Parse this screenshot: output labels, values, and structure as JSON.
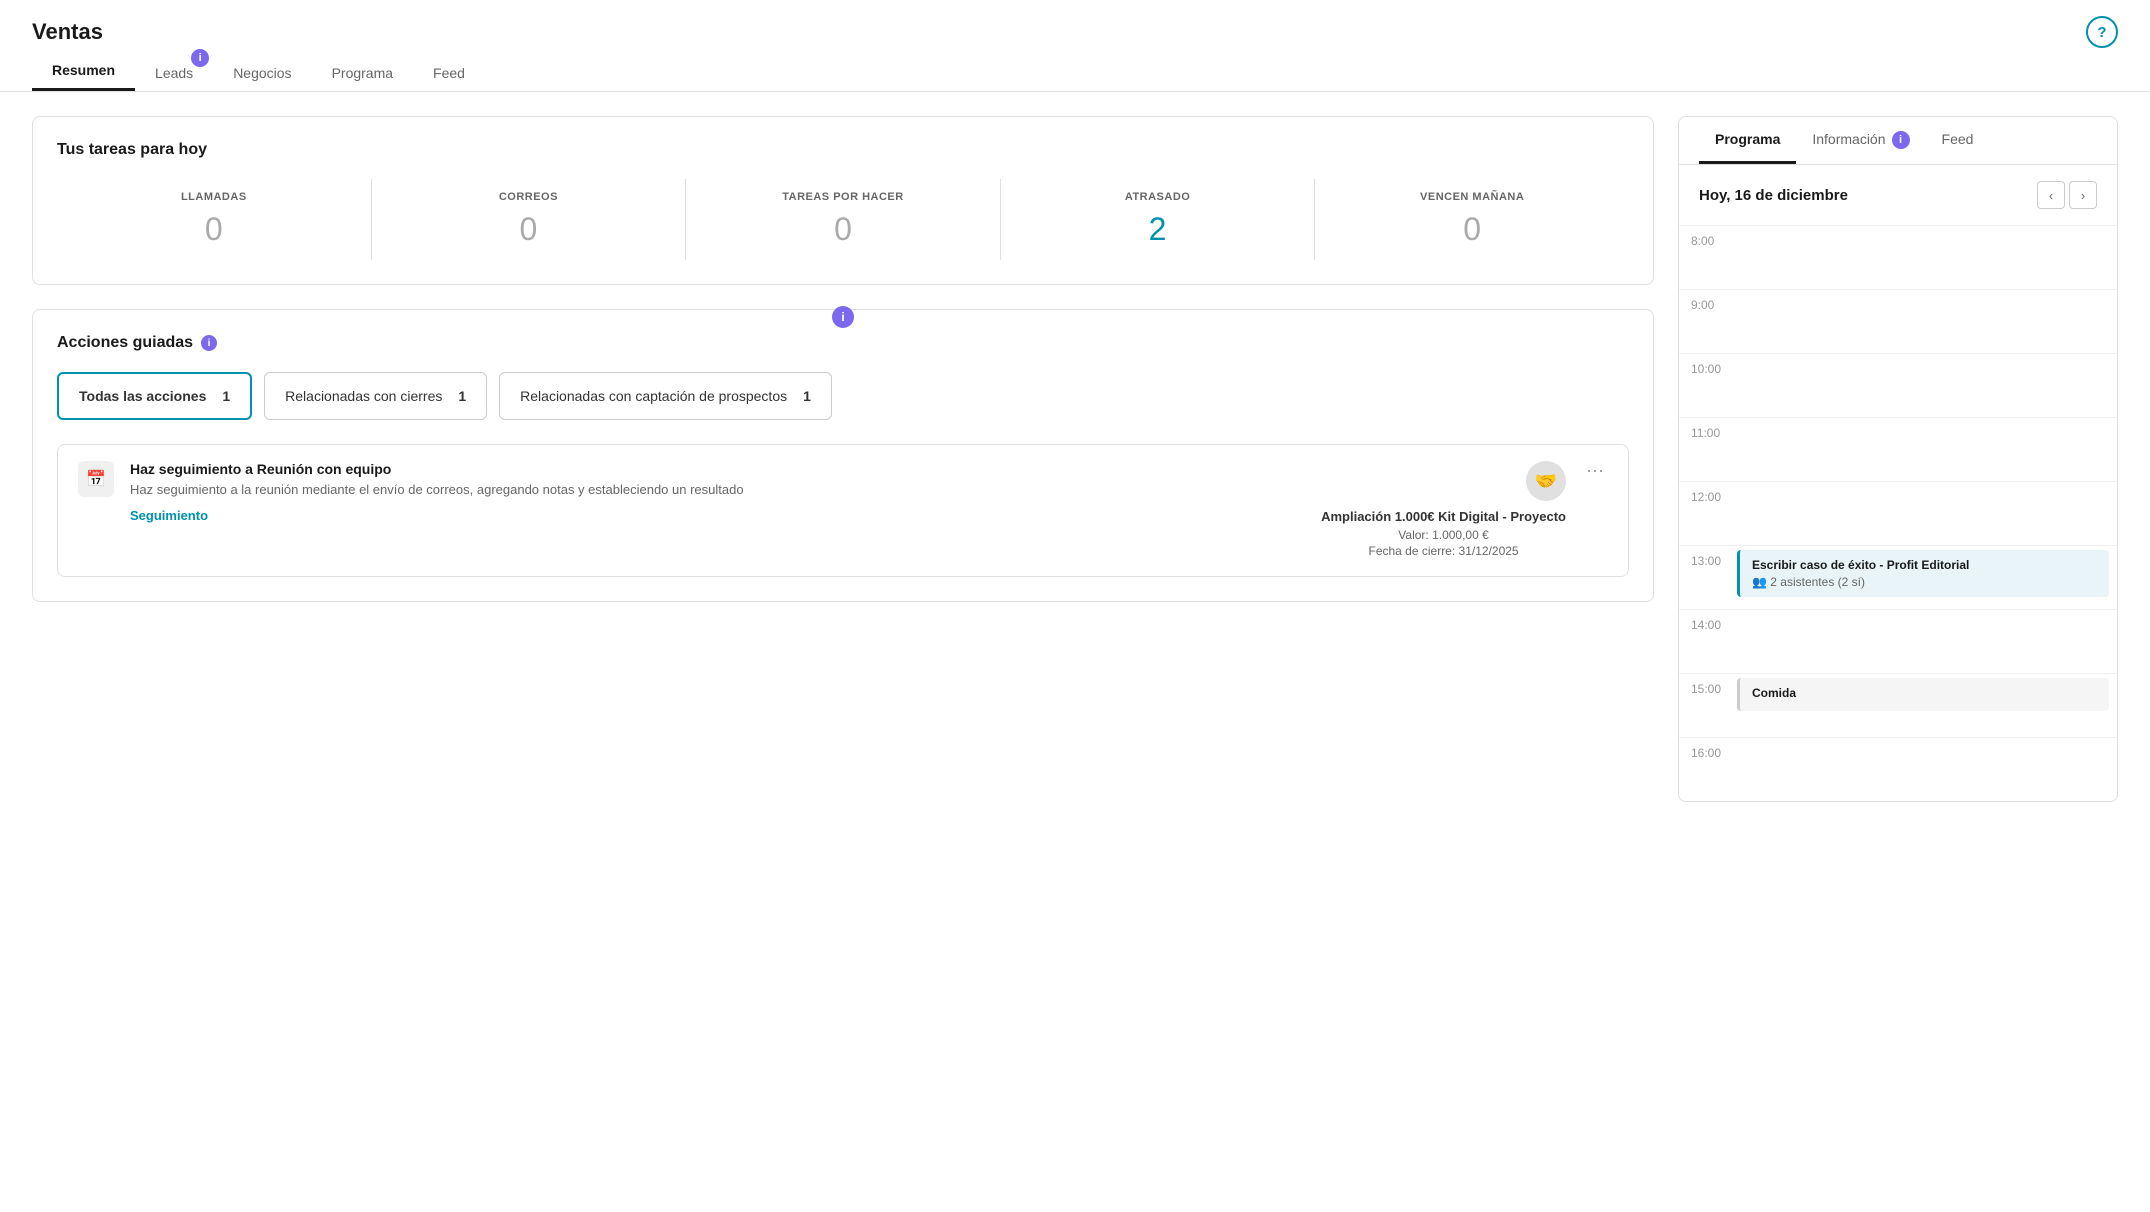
{
  "app": {
    "title": "Ventas",
    "help_icon": "?"
  },
  "nav": {
    "tabs": [
      {
        "id": "resumen",
        "label": "Resumen",
        "active": true,
        "badge": null
      },
      {
        "id": "leads",
        "label": "Leads",
        "active": false,
        "badge": "i"
      },
      {
        "id": "negocios",
        "label": "Negocios",
        "active": false,
        "badge": null
      },
      {
        "id": "programa",
        "label": "Programa",
        "active": false,
        "badge": null
      },
      {
        "id": "feed",
        "label": "Feed",
        "active": false,
        "badge": null
      }
    ]
  },
  "tasks_section": {
    "title": "Tus tareas para hoy",
    "metrics": [
      {
        "id": "llamadas",
        "label": "LLAMADAS",
        "value": "0",
        "highlight": false
      },
      {
        "id": "correos",
        "label": "CORREOS",
        "value": "0",
        "highlight": false
      },
      {
        "id": "tareas",
        "label": "TAREAS POR HACER",
        "value": "0",
        "highlight": false
      },
      {
        "id": "atrasado",
        "label": "ATRASADO",
        "value": "2",
        "highlight": true
      },
      {
        "id": "vencen",
        "label": "VENCEN MAÑANA",
        "value": "0",
        "highlight": false
      }
    ]
  },
  "guided_actions": {
    "title": "Acciones guiadas",
    "filters": [
      {
        "id": "todas",
        "label": "Todas las acciones",
        "count": 1,
        "active": true
      },
      {
        "id": "cierres",
        "label": "Relacionadas con cierres",
        "count": 1,
        "active": false
      },
      {
        "id": "captacion",
        "label": "Relacionadas con captación de prospectos",
        "count": 1,
        "active": false
      }
    ],
    "task": {
      "icon": "📅",
      "title": "Haz seguimiento a Reunión con equipo",
      "description": "Haz seguimiento a la reunión mediante el envío de correos, agregando notas y estableciendo un resultado",
      "action_label": "Seguimiento",
      "deal_name": "Ampliación 1.000€ Kit Digital - Proyecto",
      "deal_value": "Valor: 1.000,00 €",
      "deal_date": "Fecha de cierre: 31/12/2025",
      "menu_icon": "•••"
    }
  },
  "right_panel": {
    "tabs": [
      {
        "id": "programa",
        "label": "Programa",
        "active": true
      },
      {
        "id": "informacion",
        "label": "Información",
        "active": false,
        "badge": "i"
      },
      {
        "id": "feed",
        "label": "Feed",
        "active": false
      }
    ],
    "calendar": {
      "date_label": "Hoy, 16 de diciembre",
      "prev_icon": "‹",
      "next_icon": "›",
      "time_slots": [
        {
          "time": "8:00",
          "events": []
        },
        {
          "time": "9:00",
          "events": []
        },
        {
          "time": "10:00",
          "events": []
        },
        {
          "time": "11:00",
          "events": []
        },
        {
          "time": "12:00",
          "events": []
        },
        {
          "time": "13:00",
          "events": [
            {
              "title": "Escribir caso de éxito - Profit Editorial",
              "detail": "2 asistentes (2 sí)",
              "type": "blue-light",
              "detail_icon": "👥"
            }
          ]
        },
        {
          "time": "14:00",
          "events": []
        },
        {
          "time": "15:00",
          "events": [
            {
              "title": "Comida",
              "detail": "",
              "type": "gray-light"
            }
          ]
        },
        {
          "time": "16:00",
          "events": []
        }
      ]
    }
  }
}
